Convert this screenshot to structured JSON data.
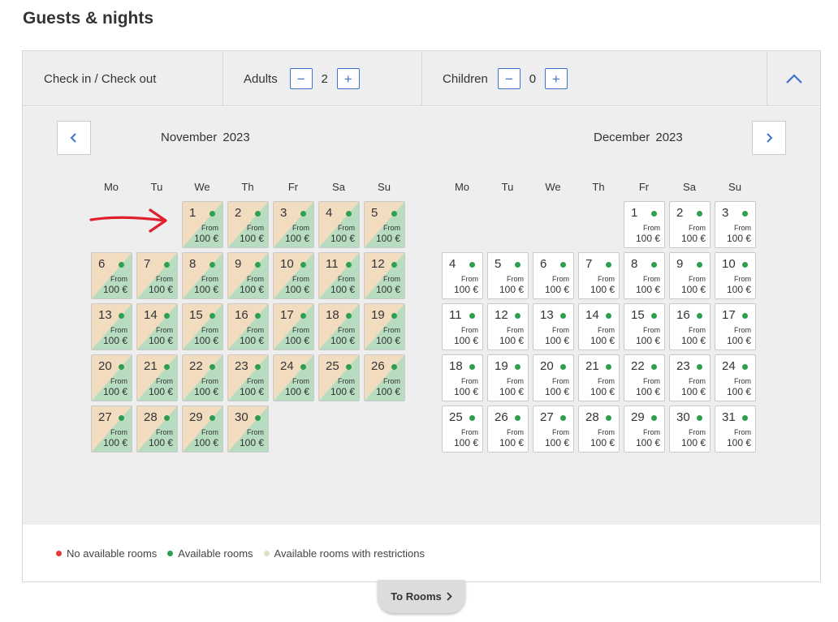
{
  "header": {
    "title": "Guests & nights"
  },
  "guests": {
    "checkin_label": "Check in / Check out",
    "adults_label": "Adults",
    "adults_value": "2",
    "children_label": "Children",
    "children_value": "0",
    "minus": "−",
    "plus": "+"
  },
  "calendar": {
    "weekdays": [
      "Mo",
      "Tu",
      "We",
      "Th",
      "Fr",
      "Sa",
      "Su"
    ],
    "months": [
      {
        "name": "November  2023",
        "first_weekday": 2,
        "days": 30,
        "restricted": true
      },
      {
        "name": "December  2023",
        "first_weekday": 4,
        "days": 31,
        "restricted": false
      }
    ],
    "from_label": "From",
    "price_label": "100 €"
  },
  "legend": [
    {
      "label": "No available rooms",
      "color": "#e53935"
    },
    {
      "label": "Available rooms",
      "color": "#2e9e4f"
    },
    {
      "label": "Available rooms with restrictions",
      "color": "#d9e3c8"
    }
  ],
  "footer": {
    "to_rooms_label": "To Rooms"
  },
  "colors": {
    "accent": "#3d73c9",
    "available": "#2e9e4f",
    "annotation_arrow": "#e0202a"
  }
}
